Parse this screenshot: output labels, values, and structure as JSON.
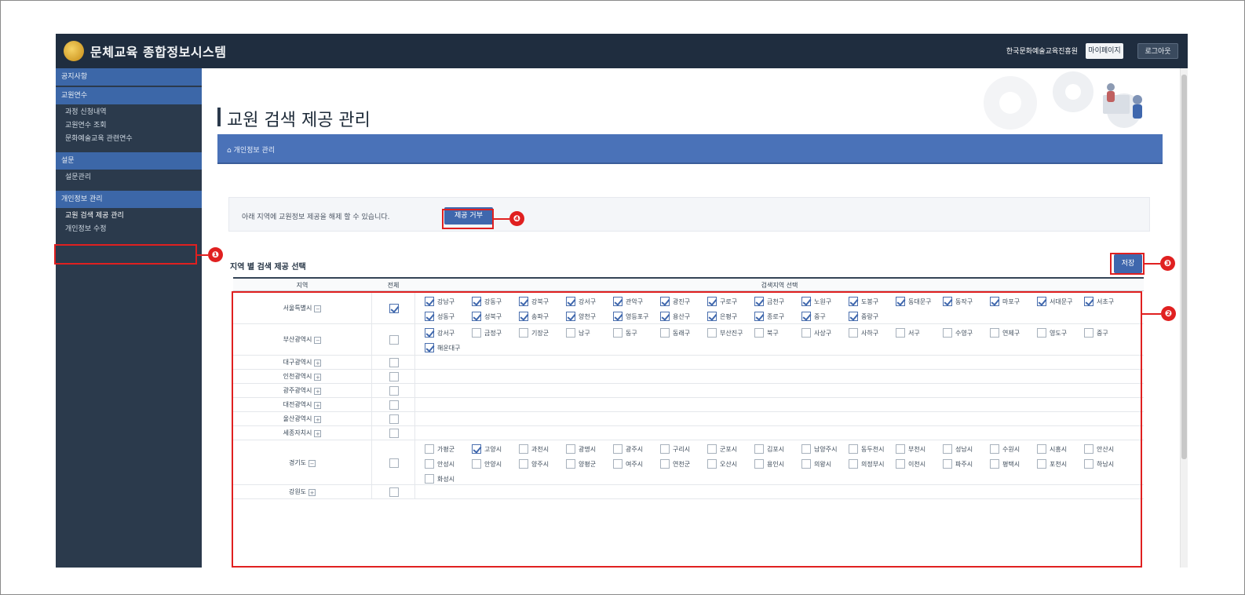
{
  "header": {
    "brand": "문체교육 종합정보시스템",
    "user_info": "한국문화예술교육진흥원",
    "user_name": "",
    "session_info": "",
    "mypage_label": "마이페이지",
    "logout_label": "로그아웃"
  },
  "sidebar": {
    "sections": [
      {
        "title": "공지사항",
        "items": []
      },
      {
        "title": "교원연수",
        "items": [
          "과정 신청내역",
          "교원연수 조회",
          "문화예술교육 관련연수"
        ]
      },
      {
        "title": "설문",
        "items": [
          "설문관리"
        ]
      },
      {
        "title": "개인정보 관리",
        "items": [
          "교원 검색 제공 관리",
          "개인정보 수정"
        ]
      }
    ]
  },
  "page": {
    "title": "교원 검색 제공 관리",
    "breadcrumb": "개인정보 관리",
    "notice": "아래 지역에 교원정보 제공을 해제 할 수 있습니다.",
    "toggle_button": "제공 거부",
    "subtitle": "지역 별 검색 제공 선택",
    "save_button": "저장"
  },
  "table": {
    "headers": [
      "지역",
      "전체",
      "검색지역 선택"
    ],
    "rows": [
      {
        "region": "서울특별시",
        "expand": "−",
        "all": true,
        "districts": [
          {
            "name": "강남구",
            "on": true
          },
          {
            "name": "강동구",
            "on": true
          },
          {
            "name": "강북구",
            "on": true
          },
          {
            "name": "강서구",
            "on": true
          },
          {
            "name": "관악구",
            "on": true
          },
          {
            "name": "광진구",
            "on": true
          },
          {
            "name": "구로구",
            "on": true
          },
          {
            "name": "금천구",
            "on": true
          },
          {
            "name": "노원구",
            "on": true
          },
          {
            "name": "도봉구",
            "on": true
          },
          {
            "name": "동대문구",
            "on": true
          },
          {
            "name": "동작구",
            "on": true
          },
          {
            "name": "마포구",
            "on": true
          },
          {
            "name": "서대문구",
            "on": true
          },
          {
            "name": "서초구",
            "on": true
          },
          {
            "name": "성동구",
            "on": true
          },
          {
            "name": "성북구",
            "on": true
          },
          {
            "name": "송파구",
            "on": true
          },
          {
            "name": "양천구",
            "on": true
          },
          {
            "name": "영등포구",
            "on": true
          },
          {
            "name": "용산구",
            "on": true
          },
          {
            "name": "은평구",
            "on": true
          },
          {
            "name": "종로구",
            "on": true
          },
          {
            "name": "중구",
            "on": true
          },
          {
            "name": "중랑구",
            "on": true
          }
        ]
      },
      {
        "region": "부산광역시",
        "expand": "−",
        "all": false,
        "districts": [
          {
            "name": "강서구",
            "on": true
          },
          {
            "name": "금정구",
            "on": false
          },
          {
            "name": "기장군",
            "on": false
          },
          {
            "name": "남구",
            "on": false
          },
          {
            "name": "동구",
            "on": false
          },
          {
            "name": "동래구",
            "on": false
          },
          {
            "name": "부산진구",
            "on": false
          },
          {
            "name": "북구",
            "on": false
          },
          {
            "name": "사상구",
            "on": false
          },
          {
            "name": "사하구",
            "on": false
          },
          {
            "name": "서구",
            "on": false
          },
          {
            "name": "수영구",
            "on": false
          },
          {
            "name": "연제구",
            "on": false
          },
          {
            "name": "영도구",
            "on": false
          },
          {
            "name": "중구",
            "on": false
          },
          {
            "name": "해운대구",
            "on": true
          }
        ]
      },
      {
        "region": "대구광역시",
        "expand": "+",
        "all": false,
        "districts": []
      },
      {
        "region": "인천광역시",
        "expand": "+",
        "all": false,
        "districts": []
      },
      {
        "region": "광주광역시",
        "expand": "+",
        "all": false,
        "districts": []
      },
      {
        "region": "대전광역시",
        "expand": "+",
        "all": false,
        "districts": []
      },
      {
        "region": "울산광역시",
        "expand": "+",
        "all": false,
        "districts": []
      },
      {
        "region": "세종자치시",
        "expand": "+",
        "all": false,
        "districts": []
      },
      {
        "region": "경기도",
        "expand": "−",
        "all": false,
        "districts": [
          {
            "name": "가평군",
            "on": false
          },
          {
            "name": "고양시",
            "on": true
          },
          {
            "name": "과천시",
            "on": false
          },
          {
            "name": "광명시",
            "on": false
          },
          {
            "name": "광주시",
            "on": false
          },
          {
            "name": "구리시",
            "on": false
          },
          {
            "name": "군포시",
            "on": false
          },
          {
            "name": "김포시",
            "on": false
          },
          {
            "name": "남양주시",
            "on": false
          },
          {
            "name": "동두천시",
            "on": false
          },
          {
            "name": "부천시",
            "on": false
          },
          {
            "name": "성남시",
            "on": false
          },
          {
            "name": "수원시",
            "on": false
          },
          {
            "name": "시흥시",
            "on": false
          },
          {
            "name": "안산시",
            "on": false
          },
          {
            "name": "안성시",
            "on": false
          },
          {
            "name": "안양시",
            "on": false
          },
          {
            "name": "양주시",
            "on": false
          },
          {
            "name": "양평군",
            "on": false
          },
          {
            "name": "여주시",
            "on": false
          },
          {
            "name": "연천군",
            "on": false
          },
          {
            "name": "오산시",
            "on": false
          },
          {
            "name": "용인시",
            "on": false
          },
          {
            "name": "의왕시",
            "on": false
          },
          {
            "name": "의정부시",
            "on": false
          },
          {
            "name": "이천시",
            "on": false
          },
          {
            "name": "파주시",
            "on": false
          },
          {
            "name": "평택시",
            "on": false
          },
          {
            "name": "포천시",
            "on": false
          },
          {
            "name": "하남시",
            "on": false
          },
          {
            "name": "화성시",
            "on": false
          }
        ]
      },
      {
        "region": "강원도",
        "expand": "+",
        "all": false,
        "districts": []
      }
    ]
  },
  "annotations": [
    "❶",
    "❷",
    "❸",
    "❹"
  ],
  "colors": {
    "accent": "#3f67ad",
    "annotation": "#e02020",
    "sidebar": "#2b3a4c",
    "topbar": "#1f2d3f"
  }
}
